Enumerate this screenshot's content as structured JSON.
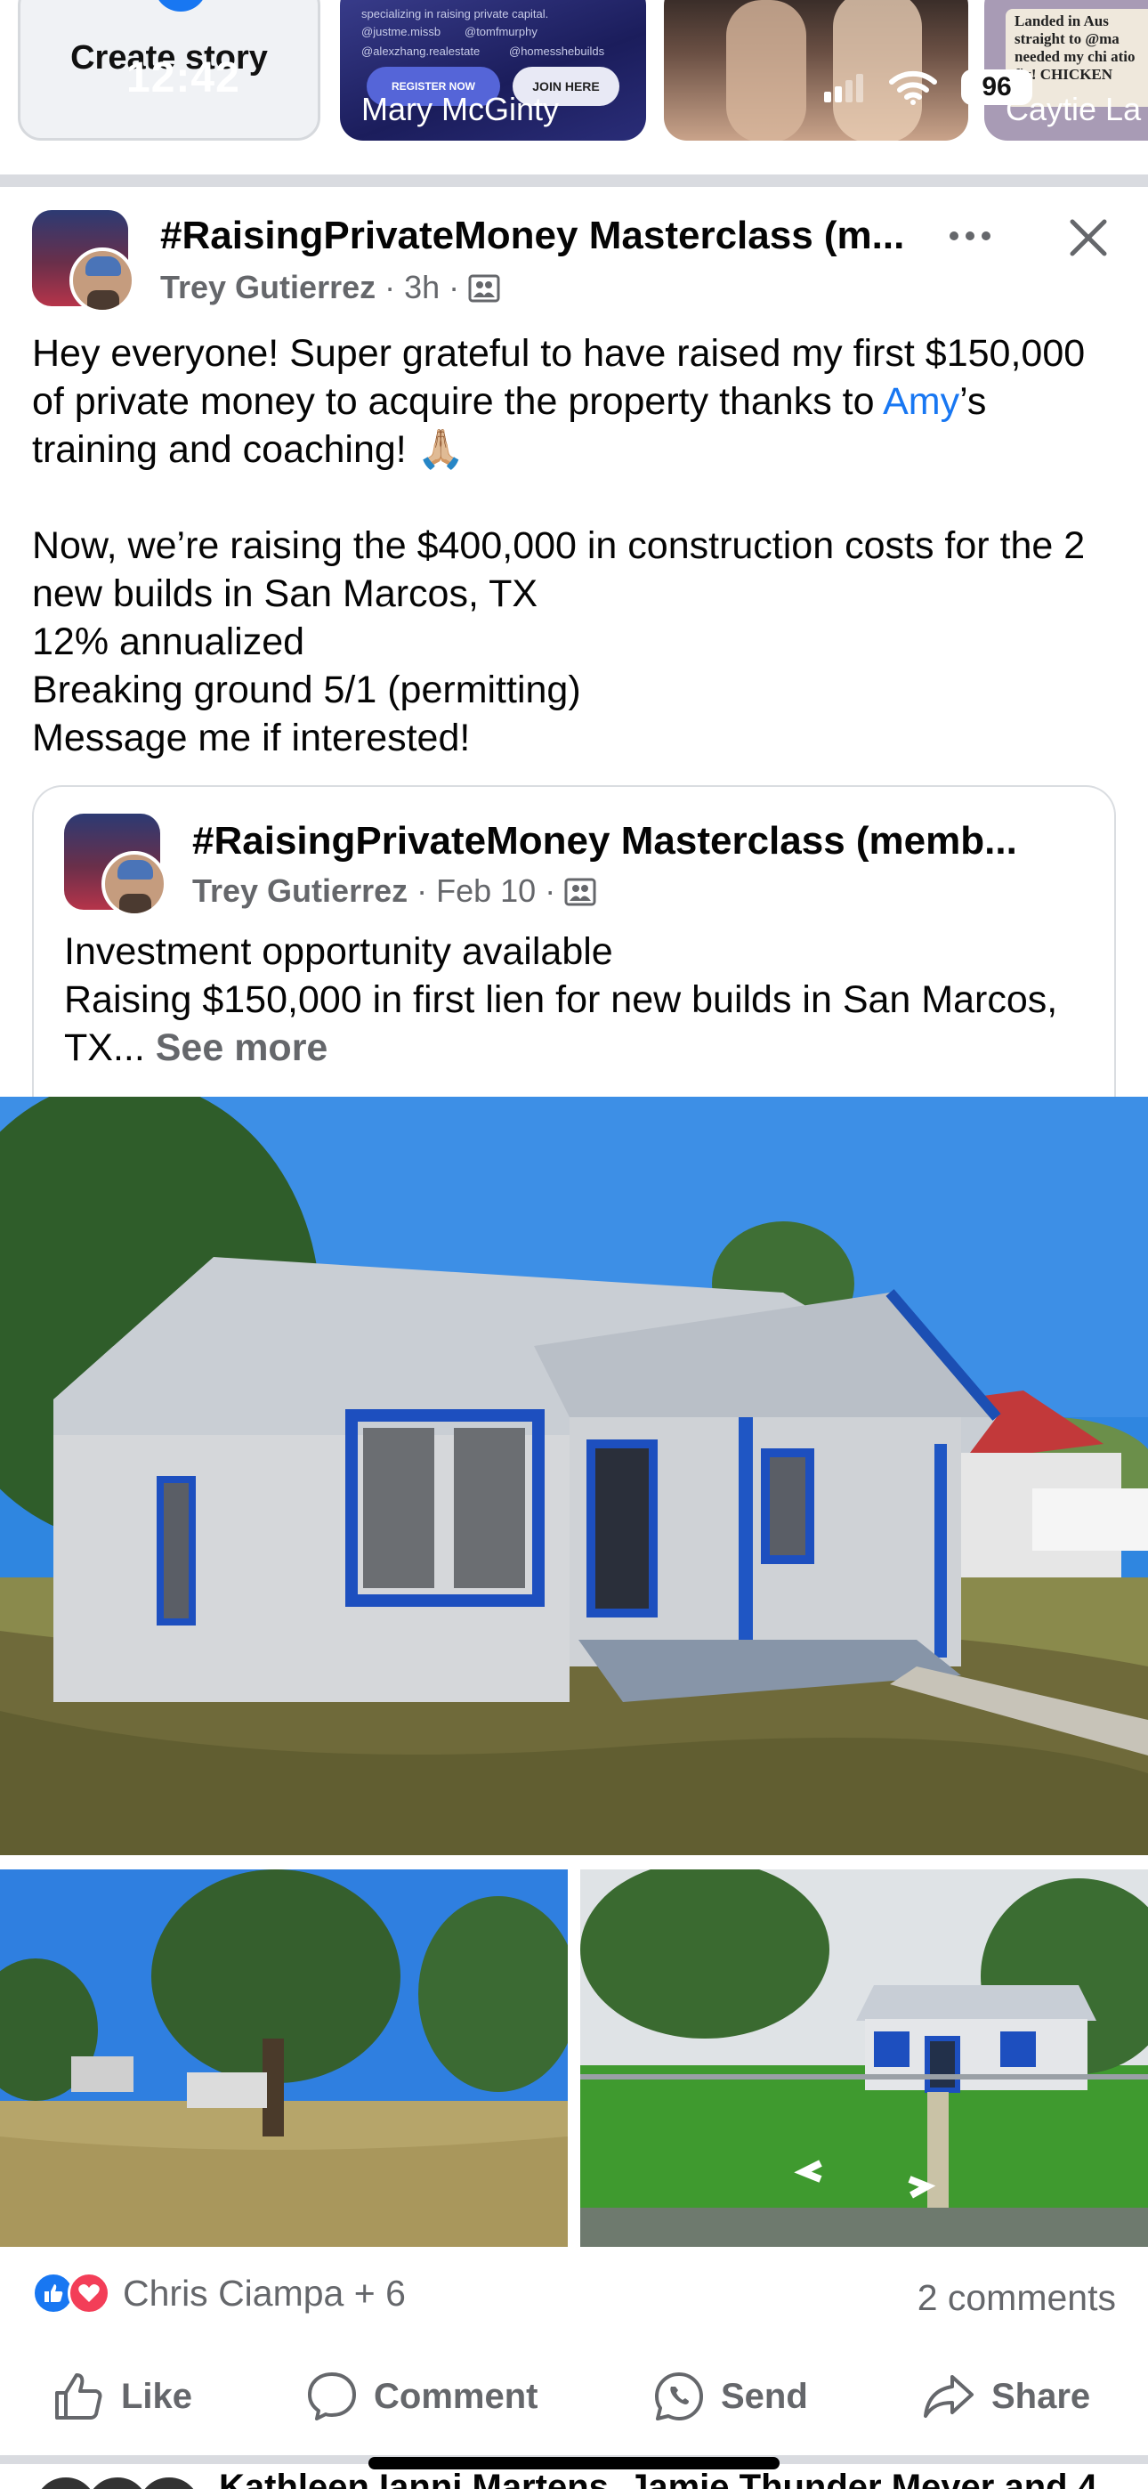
{
  "status_bar": {
    "time": "12:42",
    "battery": "96"
  },
  "stories": {
    "create_label": "Create story",
    "items": [
      {
        "name": "Mary McGinty",
        "register": "REGISTER NOW",
        "join": "JOIN HERE",
        "handles": [
          "@justme.missb",
          "@tomfmurphy",
          "@alexzhang.realestate",
          "@homesshebuilds"
        ],
        "caption": "specializing in raising private capital."
      },
      {
        "name": ""
      },
      {
        "name": "Caytie La",
        "sign": "Landed in Aus straight to @ma needed my chi atio fix! CHICKEN"
      }
    ]
  },
  "post": {
    "group_title": "#RaisingPrivateMoney Masterclass (m...",
    "author": "Trey Gutierrez",
    "time": "3h",
    "body_line1_prefix": "Hey everyone! Super grateful to have raised my first $150,000 of private money to acquire the property thanks to ",
    "mention": "Amy",
    "body_line1_suffix": "’s training and coaching! 🙏🏼",
    "body_rest": "Now, we’re raising the $400,000 in construction costs for the 2 new builds in San Marcos, TX\n12% annualized\nBreaking ground 5/1 (permitting)\nMessage me if interested!"
  },
  "shared_post": {
    "group_title": "#RaisingPrivateMoney Masterclass (memb...",
    "author": "Trey Gutierrez",
    "time": "Feb 10",
    "text": "Investment opportunity available\nRaising $150,000 in first lien for new builds in San Marcos, TX... ",
    "see_more": "See more"
  },
  "footer": {
    "reactions_text": "Chris Ciampa + 6",
    "comments": "2 comments",
    "like": "Like",
    "comment": "Comment",
    "send": "Send",
    "share": "Share"
  },
  "next_post_peek": "Kathleen Ianni Martens, Jamie Thunder Meyer and 4",
  "colors": {
    "brand_blue": "#1877f2",
    "secondary_text": "#65676b",
    "love_red": "#f33e58"
  },
  "icons": [
    "more-dots-icon",
    "close-icon",
    "group-privacy-icon",
    "like-reaction-icon",
    "love-reaction-icon",
    "like-icon",
    "comment-icon",
    "send-icon",
    "share-icon"
  ]
}
